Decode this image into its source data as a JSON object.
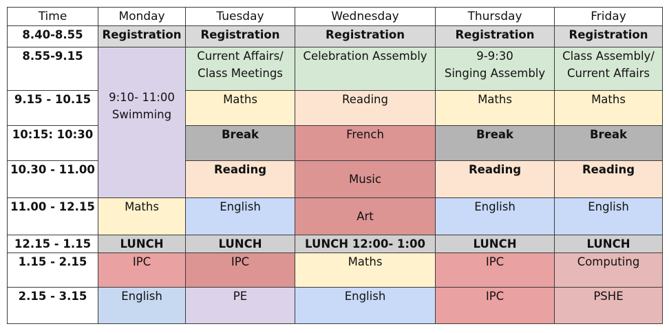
{
  "headers": [
    "Time",
    "Monday",
    "Tuesday",
    "Wednesday",
    "Thursday",
    "Friday"
  ],
  "times": [
    "8.40-8.55",
    "8.55-9.15",
    "9.15 - 10.15",
    "10:15: 10:30",
    "10.30 - 11.00",
    "11.00 - 12.15",
    "12.15 - 1.15",
    "1.15 - 2.15",
    "2.15 - 3.15"
  ],
  "cells": {
    "reg": "Registration",
    "mon_swim_1": "9:10- 11:00",
    "mon_swim_2": "Swimming",
    "mon_maths": "Maths",
    "mon_lunch": "LUNCH",
    "mon_ipc": "IPC",
    "mon_english": "English",
    "tue_current_1": "Current Affairs/",
    "tue_current_2": "Class Meetings",
    "tue_maths": "Maths",
    "tue_break": "Break",
    "tue_reading": "Reading",
    "tue_english": "English",
    "tue_lunch": "LUNCH",
    "tue_ipc": "IPC",
    "tue_pe": "PE",
    "wed_celebration": "Celebration Assembly",
    "wed_reading": "Reading",
    "wed_french": "French",
    "wed_music": "Music",
    "wed_art": "Art",
    "wed_lunch": "LUNCH 12:00- 1:00",
    "wed_maths": "Maths",
    "wed_english": "English",
    "thu_singing_1": "9-9:30",
    "thu_singing_2": "Singing Assembly",
    "thu_maths": "Maths",
    "thu_break": "Break",
    "thu_reading": "Reading",
    "thu_english": "English",
    "thu_lunch": "LUNCH",
    "thu_ipc_1": "IPC",
    "thu_ipc_2": "IPC",
    "fri_assembly_1": "Class Assembly/",
    "fri_assembly_2": "Current Affairs",
    "fri_maths": "Maths",
    "fri_break": "Break",
    "fri_reading": "Reading",
    "fri_english": "English",
    "fri_lunch": "LUNCH",
    "fri_computing": "Computing",
    "fri_pshe": "PSHE"
  }
}
